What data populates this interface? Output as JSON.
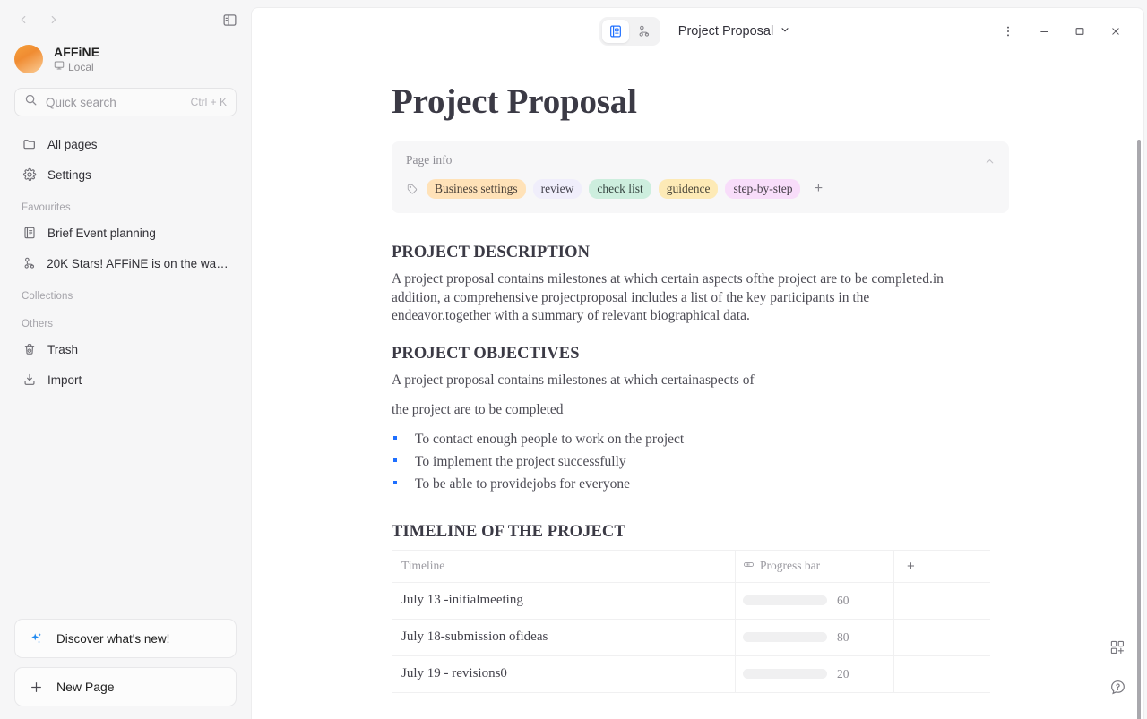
{
  "sidebar": {
    "nav": {
      "back": "back-arrow",
      "forward": "forward-arrow",
      "toggle": "sidebar-toggle"
    },
    "workspace": {
      "name": "AFFiNE",
      "sub": "Local",
      "sub_icon": "monitor-icon"
    },
    "search": {
      "placeholder": "Quick search",
      "shortcut": "Ctrl + K"
    },
    "primary_items": [
      {
        "label": "All pages",
        "icon": "folder-icon"
      },
      {
        "label": "Settings",
        "icon": "gear-icon"
      }
    ],
    "sections": [
      {
        "title": "Favourites",
        "items": [
          {
            "label": "Brief Event planning",
            "icon": "page-icon"
          },
          {
            "label": "20K Stars! AFFiNE is on the way t...",
            "icon": "edgeless-icon"
          }
        ]
      },
      {
        "title": "Collections",
        "items": []
      },
      {
        "title": "Others",
        "items": [
          {
            "label": "Trash",
            "icon": "trash-icon"
          },
          {
            "label": "Import",
            "icon": "import-icon"
          }
        ]
      }
    ],
    "bottom": {
      "discover_label": "Discover what's new!",
      "discover_icon": "sparkle-icon",
      "new_page_label": "New Page",
      "new_page_icon": "plus-icon"
    }
  },
  "header": {
    "mode_page_icon": "page-mode-icon",
    "mode_edgeless_icon": "edgeless-mode-icon",
    "doc_title": "Project Proposal",
    "doc_title_caret": "chevron-down-icon",
    "window": {
      "more": "more-vertical-icon",
      "minimize": "minimize-icon",
      "maximize": "maximize-icon",
      "close": "close-icon"
    }
  },
  "doc": {
    "title": "Project Proposal",
    "page_info": {
      "label": "Page info",
      "collapse_icon": "chevron-up-icon",
      "tag_icon": "tag-icon",
      "add_label": "+",
      "tags": [
        {
          "label": "Business settings",
          "bg": "#ffe2b8",
          "fg": "#4a4139"
        },
        {
          "label": "review",
          "bg": "#f0eefb",
          "fg": "#43414c"
        },
        {
          "label": "check list",
          "bg": "#cdeede",
          "fg": "#374642"
        },
        {
          "label": "guidence",
          "bg": "#fdeab6",
          "fg": "#4a4639"
        },
        {
          "label": "step-by-step",
          "bg": "#f8ddfa",
          "fg": "#47404a"
        }
      ]
    },
    "sections": [
      {
        "heading": "PROJECT DESCRIPTION",
        "paragraphs": [
          "A project proposal contains milestones at which certain aspects ofthe project are to be completed.in addition, a comprehensive projectproposal includes a list of the key participants in the endeavor.together with a summary of relevant biographical data."
        ]
      },
      {
        "heading": "PROJECT OBJECTIVES",
        "paragraphs": [
          "A project proposal contains milestones at which certainaspects of",
          "the project are to be completed"
        ],
        "bullets": [
          "To contact enough people to work on the project",
          "To implement the project successfully",
          "To be able to providejobs for everyone"
        ]
      },
      {
        "heading": "TIMELINE OF THE PROJECT"
      }
    ],
    "table": {
      "columns": [
        {
          "label": "Timeline",
          "icon": null
        },
        {
          "label": "Progress bar",
          "icon": "progress-icon"
        },
        {
          "label": "+",
          "icon": "plus-icon"
        }
      ],
      "rows": [
        {
          "timeline": "July 13 -initialmeeting",
          "progress": 60
        },
        {
          "timeline": "July 18-submission ofideas",
          "progress": 80
        },
        {
          "timeline": "July 19 - revisions0",
          "progress": 20
        }
      ]
    },
    "float_buttons": [
      {
        "name": "add-block-icon"
      },
      {
        "name": "help-icon"
      }
    ]
  },
  "colors": {
    "accent_blue": "#1e6fff",
    "sidebar_bg": "#f6f6f7",
    "panel_bg": "#ffffff"
  }
}
